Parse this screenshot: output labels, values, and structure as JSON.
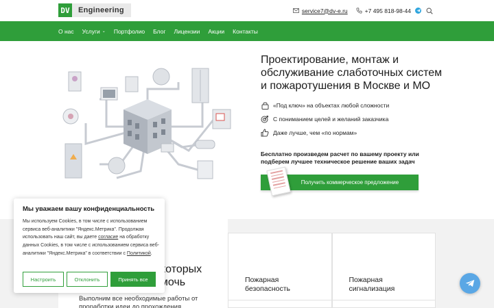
{
  "header": {
    "logo_badge": "DV",
    "logo_text": "Engineering",
    "email": "service7@dv-e.ru",
    "phone": "+7 495 818-98-44"
  },
  "nav": {
    "items": [
      {
        "label": "О нас"
      },
      {
        "label": "Услуги",
        "chevron": "⌄"
      },
      {
        "label": "Портфолио"
      },
      {
        "label": "Блог"
      },
      {
        "label": "Лицензии"
      },
      {
        "label": "Акции"
      },
      {
        "label": "Контакты"
      }
    ]
  },
  "hero": {
    "title": "Проектирование, монтаж и обслуживание слаботочных систем и пожаротушения в Москве и МО",
    "features": [
      {
        "icon": "lock-icon",
        "text": "«Под ключ» на объектах любой сложности"
      },
      {
        "icon": "target-icon",
        "text": "С пониманием целей и желаний заказчика"
      },
      {
        "icon": "thumb-up-icon",
        "text": "Даже лучше, чем «по нормам»"
      }
    ],
    "offer_text": "Бесплатно произведем расчет по вашему проекту или подберем лучшее техническое решение ваших задач",
    "cta_label": "Получить коммерческое предложение"
  },
  "lower": {
    "heading_line1": "которых",
    "heading_line2": "омочь",
    "sub_text": "Выполним все необходимые работы от проработки идеи до прохождения",
    "cards": [
      {
        "label": "Пожарная безопасность"
      },
      {
        "label": "Пожарная сигнализация"
      }
    ]
  },
  "cookie": {
    "title": "Мы уважаем вашу конфиденциальность",
    "text_before": "Мы используем Cookies, в том числе с использованием сервиса веб-аналитики \"Яндекс.Метрика\". Продолжая использовать наш сайт, вы даете ",
    "consent_link": "согласие",
    "text_middle": " на обработку данных Cookies, в том числе с использованием сервиса веб-аналитики \"Яндекс.Метрика\" в соответствии с ",
    "policy_link": "Политикой",
    "text_after": ".",
    "buttons": {
      "settings": "Настроить",
      "decline": "Отклонить",
      "accept": "Принять все"
    }
  },
  "colors": {
    "brand_green": "#2f9e3a",
    "telegram_blue": "#5aa7e5"
  }
}
